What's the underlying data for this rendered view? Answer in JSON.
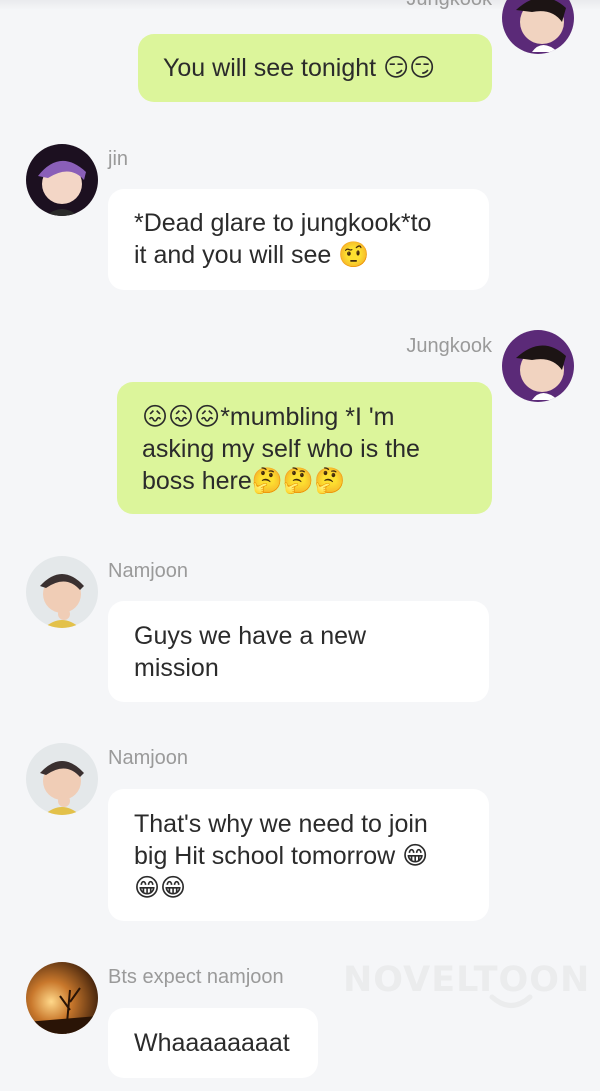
{
  "header": {
    "cut_sender_name": "Jungkook"
  },
  "messages": [
    {
      "sender": "Jungkook",
      "show_name": false,
      "side": "right",
      "avatar": "jungkook-avatar",
      "text": "You will see tonight",
      "emoji": "😏😏"
    },
    {
      "sender": "jin",
      "show_name": true,
      "side": "left",
      "avatar": "jin-avatar",
      "line1": "*Dead glare to jungkook*to",
      "line2": "it and you will see",
      "emoji": "🤨"
    },
    {
      "sender": "Jungkook",
      "show_name": true,
      "side": "right",
      "avatar": "jungkook-avatar",
      "emoji_lead": "😖😖😖",
      "line1": "*mumbling *I 'm",
      "line2": "asking my self who is the",
      "line3": "boss here",
      "emoji_trail": "🤔🤔🤔"
    },
    {
      "sender": "Namjoon",
      "show_name": true,
      "side": "left",
      "avatar": "namjoon-avatar",
      "line1": "Guys we have a new",
      "line2": "mission"
    },
    {
      "sender": "Namjoon",
      "show_name": true,
      "side": "left",
      "avatar": "namjoon-avatar",
      "line1": "That's why we need to join",
      "line2": "big Hit school tomorrow",
      "emoji_inline": "😁",
      "emoji_line3": "😁😁"
    },
    {
      "sender": "Bts expect namjoon",
      "show_name": true,
      "side": "left",
      "avatar": "sunset-avatar",
      "text": "Whaaaaaaaat"
    }
  ],
  "watermark": {
    "text": "NOVELTOON"
  },
  "colors": {
    "background": "#f5f6f8",
    "outgoing_bubble": "#dcf59b",
    "incoming_bubble": "#ffffff",
    "name_text": "#9a9a9a",
    "message_text": "#2b2b2b"
  }
}
